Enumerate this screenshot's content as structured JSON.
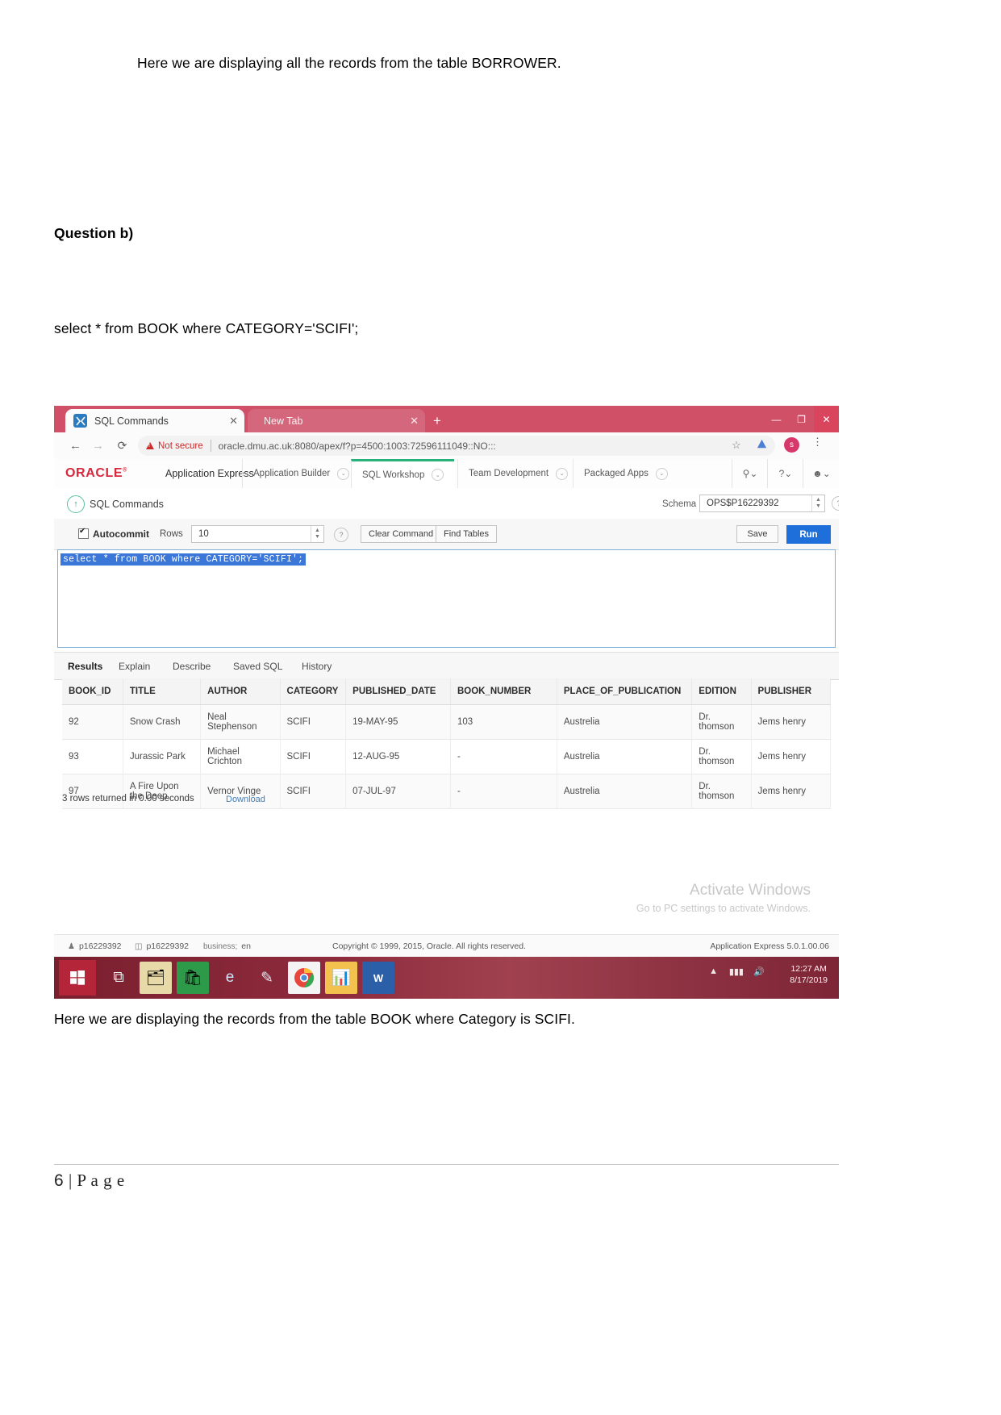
{
  "document": {
    "intro_text": "Here we are displaying all the records from the table BORROWER.",
    "question_label": "Question b)",
    "sql_statement": "select * from BOOK where CATEGORY='SCIFI';",
    "caption_text": "Here we are displaying the records from the table BOOK where Category is SCIFI.",
    "page_number": "6",
    "page_word": "P a g e",
    "page_separator": "|"
  },
  "browser": {
    "tabs": [
      {
        "title": "SQL Commands",
        "close": "✕",
        "favicon": "apex-favicon"
      },
      {
        "title": "New Tab",
        "close": "✕",
        "favicon": "none"
      }
    ],
    "new_tab_plus": "+",
    "window_controls": {
      "minimize": "—",
      "maximize": "❐",
      "close": "✕"
    },
    "nav": {
      "back": "←",
      "forward": "→",
      "reload": "⟳"
    },
    "security_label": "Not secure",
    "url": "oracle.dmu.ac.uk:8080/apex/f?p=4500:1003:72596111049::NO:::",
    "star": "☆",
    "profile_initial": "s",
    "menu": "⋮"
  },
  "apex": {
    "logo": "ORACLE",
    "logo_reg": "®",
    "product": "Application Express",
    "nav_items": [
      {
        "label": "Application Builder",
        "chevron": "⌄"
      },
      {
        "label": "SQL Workshop",
        "chevron": "⌄"
      },
      {
        "label": "Team Development",
        "chevron": "⌄"
      },
      {
        "label": "Packaged Apps",
        "chevron": "⌄"
      }
    ],
    "nav_icons": [
      {
        "name": "user-admin-icon",
        "glyph": "⚲⌄"
      },
      {
        "name": "help-icon",
        "glyph": "?⌄"
      },
      {
        "name": "account-icon",
        "glyph": "☻⌄"
      }
    ],
    "breadcrumb": {
      "up_arrow": "↑",
      "label": "SQL Commands",
      "schema_label": "Schema",
      "schema_value": "OPS$P16229392",
      "help": "?"
    },
    "toolbar": {
      "autocommit_label": "Autocommit",
      "autocommit_checked": true,
      "rows_label": "Rows",
      "rows_value": "10",
      "help": "?",
      "clear_command_label": "Clear Command",
      "find_tables_label": "Find Tables",
      "save_label": "Save",
      "run_label": "Run"
    },
    "editor": {
      "sql_text": "select * from BOOK where CATEGORY='SCIFI';",
      "selected": true
    },
    "result_tabs": [
      {
        "label": "Results",
        "active": true
      },
      {
        "label": "Explain",
        "active": false
      },
      {
        "label": "Describe",
        "active": false
      },
      {
        "label": "Saved SQL",
        "active": false
      },
      {
        "label": "History",
        "active": false
      }
    ],
    "results": {
      "columns": [
        "BOOK_ID",
        "TITLE",
        "AUTHOR",
        "CATEGORY",
        "PUBLISHED_DATE",
        "BOOK_NUMBER",
        "PLACE_OF_PUBLICATION",
        "EDITION",
        "PUBLISHER"
      ],
      "rows": [
        [
          "92",
          "Snow Crash",
          "Neal Stephenson",
          "SCIFI",
          "19-MAY-95",
          "103",
          "Austrelia",
          "Dr. thomson",
          "Jems henry"
        ],
        [
          "93",
          "Jurassic Park",
          "Michael Crichton",
          "SCIFI",
          "12-AUG-95",
          "-",
          "Austrelia",
          "Dr. thomson",
          "Jems henry"
        ],
        [
          "97",
          "A Fire Upon the Deep",
          "Vernor Vinge",
          "SCIFI",
          "07-JUL-97",
          "-",
          "Austrelia",
          "Dr. thomson",
          "Jems henry"
        ]
      ],
      "status": "3 rows returned in 0.00 seconds",
      "download_label": "Download"
    },
    "footer": {
      "user": "p16229392",
      "schema": "p16229392",
      "language": "en",
      "copyright": "Copyright © 1999, 2015, Oracle. All rights reserved.",
      "version": "Application Express 5.0.1.00.06"
    }
  },
  "watermark": {
    "title": "Activate Windows",
    "subtitle": "Go to PC settings to activate Windows."
  },
  "taskbar": {
    "start_icon": "windows-logo",
    "items": [
      {
        "name": "taskview-icon",
        "glyph": "⧉"
      },
      {
        "name": "file-explorer-icon",
        "glyph": "🗂"
      },
      {
        "name": "store-icon",
        "glyph": "🛍"
      },
      {
        "name": "internet-explorer-icon",
        "glyph": "e"
      },
      {
        "name": "onenote-icon",
        "glyph": "✎"
      },
      {
        "name": "chrome-icon",
        "glyph": "◉"
      },
      {
        "name": "charts-app-icon",
        "glyph": "📊"
      },
      {
        "name": "word-icon",
        "glyph": "W"
      }
    ],
    "tray": {
      "expand": "▲",
      "network": "▮▮▮",
      "volume": "🔊"
    },
    "clock_time": "12:27 AM",
    "clock_date": "8/17/2019"
  }
}
